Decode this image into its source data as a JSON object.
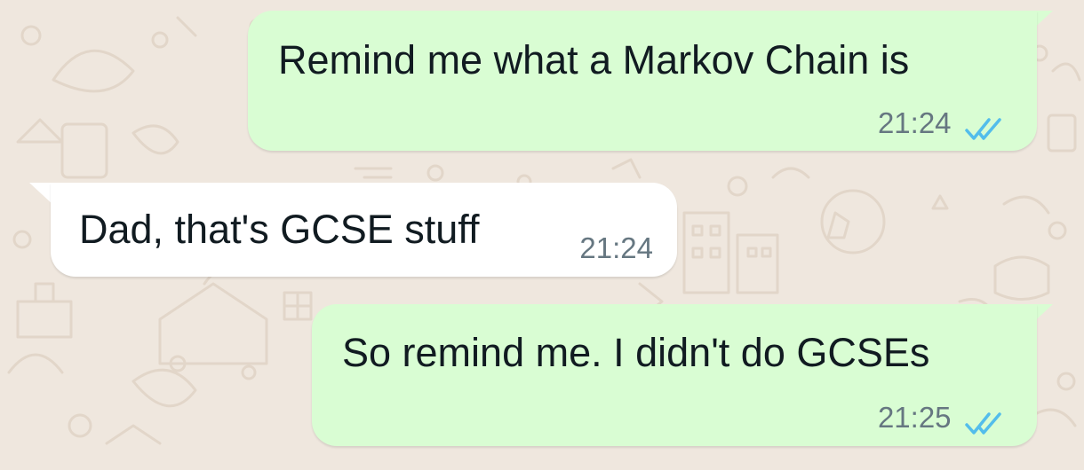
{
  "chat": {
    "messages": [
      {
        "direction": "outgoing",
        "text": "Remind me what a Markov Chain is",
        "time": "21:24",
        "status": "read"
      },
      {
        "direction": "incoming",
        "text": "Dad, that's GCSE stuff",
        "time": "21:24"
      },
      {
        "direction": "outgoing",
        "text": "So remind me. I didn't do GCSEs",
        "time": "21:25",
        "status": "read"
      }
    ]
  },
  "icons": {
    "read_receipt": "double-check-icon",
    "wallpaper": "doodle-pattern"
  },
  "colors": {
    "background": "#efe7de",
    "outgoing_bubble": "#d9fdd3",
    "incoming_bubble": "#ffffff",
    "text": "#111b21",
    "timestamp": "#667781",
    "read_tick": "#53bdeb",
    "doodle": "#e2d6c9"
  }
}
